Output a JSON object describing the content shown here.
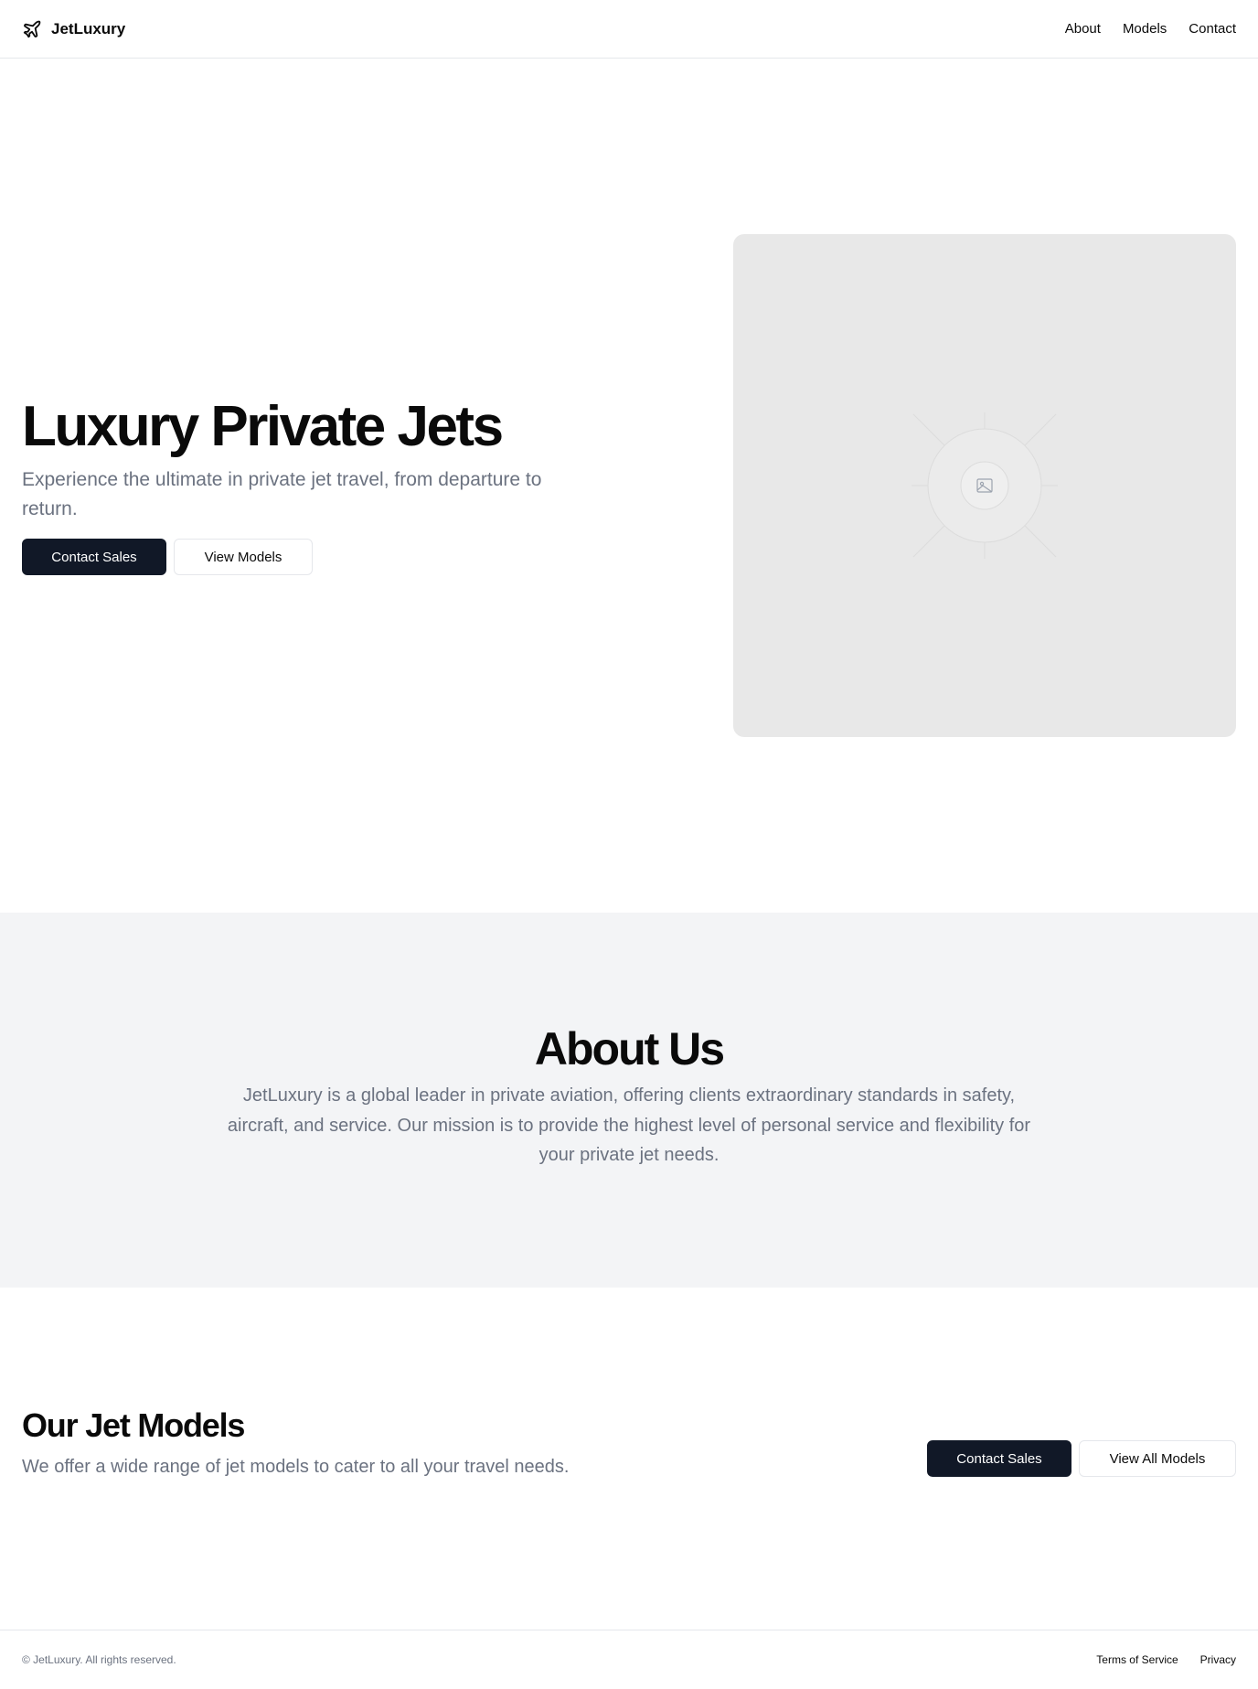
{
  "header": {
    "brand_name": "JetLuxury",
    "brand_icon": "plane-icon",
    "nav": [
      {
        "label": "About"
      },
      {
        "label": "Models"
      },
      {
        "label": "Contact"
      }
    ]
  },
  "hero": {
    "title": "Luxury Private Jets",
    "subtitle": "Experience the ultimate in private jet travel, from departure to return.",
    "primary_button": "Contact Sales",
    "secondary_button": "View Models",
    "image_icon": "image-placeholder-icon"
  },
  "about": {
    "title": "About Us",
    "body": "JetLuxury is a global leader in private aviation, offering clients extraordinary standards in safety, aircraft, and service. Our mission is to provide the highest level of personal service and flexibility for your private jet needs."
  },
  "models": {
    "title": "Our Jet Models",
    "subtitle": "We offer a wide range of jet models to cater to all your travel needs.",
    "primary_button": "Contact Sales",
    "secondary_button": "View All Models"
  },
  "footer": {
    "copyright": "© JetLuxury. All rights reserved.",
    "links": [
      {
        "label": "Terms of Service"
      },
      {
        "label": "Privacy"
      }
    ]
  },
  "colors": {
    "primary": "#111827",
    "muted_text": "#6b7280",
    "section_bg": "#f3f4f6",
    "placeholder_bg": "#e8e8e8"
  }
}
